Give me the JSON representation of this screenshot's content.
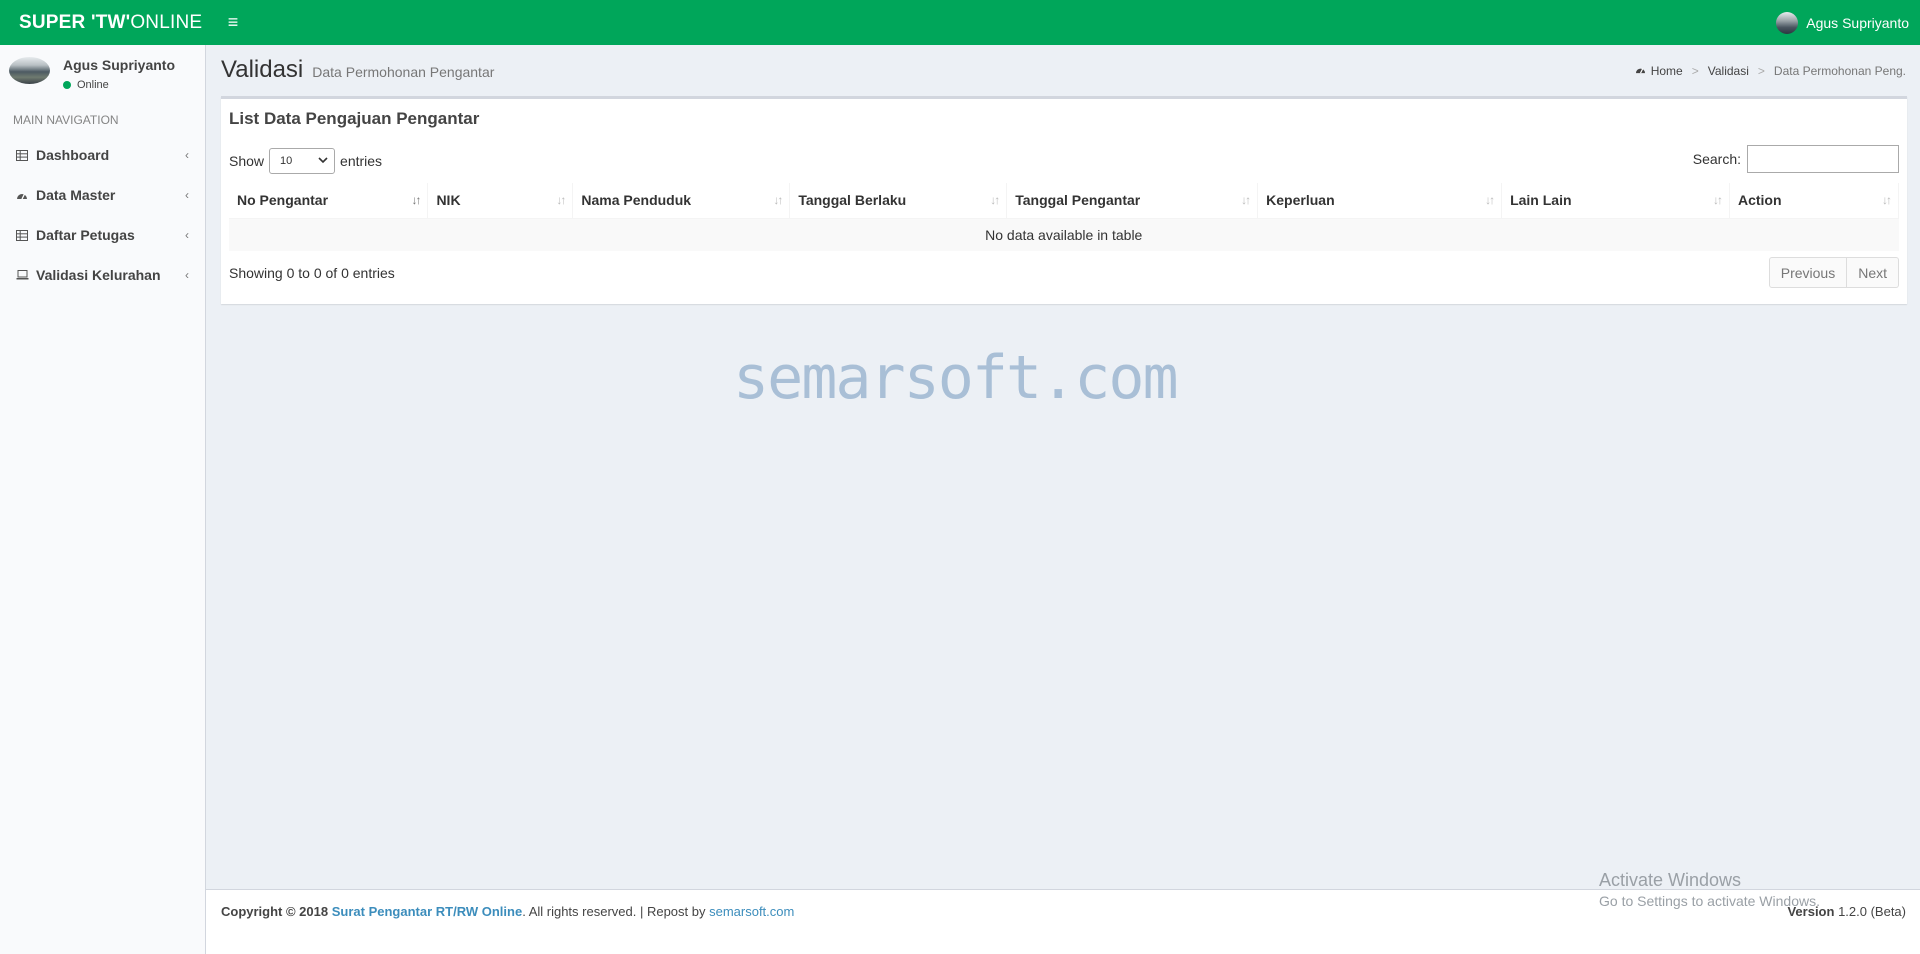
{
  "app": {
    "logo_bold": "SUPER 'TW'",
    "logo_rest": "ONLINE",
    "user_name": "Agus Supriyanto"
  },
  "sidebar": {
    "user_name": "Agus Supriyanto",
    "status": "Online",
    "nav_header": "MAIN NAVIGATION",
    "items": [
      {
        "label": "Dashboard",
        "icon": "table-icon"
      },
      {
        "label": "Data Master",
        "icon": "dashboard-icon"
      },
      {
        "label": "Daftar Petugas",
        "icon": "table-icon"
      },
      {
        "label": "Validasi Kelurahan",
        "icon": "laptop-icon"
      }
    ]
  },
  "content_header": {
    "title": "Validasi",
    "subtitle": "Data Permohonan Pengantar"
  },
  "breadcrumb": {
    "home": "Home",
    "section": "Validasi",
    "current": "Data Permohonan Peng."
  },
  "box": {
    "title": "List Data Pengajuan Pengantar",
    "show_label": "Show",
    "entries_label": "entries",
    "page_length": "10",
    "search_label": "Search:",
    "search_value": ""
  },
  "table": {
    "columns": [
      "No Pengantar",
      "NIK",
      "Nama Penduduk",
      "Tanggal Berlaku",
      "Tanggal Pengantar",
      "Keperluan",
      "Lain Lain",
      "Action"
    ],
    "empty_message": "No data available in table"
  },
  "pagination": {
    "info": "Showing 0 to 0 of 0 entries",
    "previous": "Previous",
    "next": "Next"
  },
  "watermark": "semarsoft.com",
  "footer": {
    "copyright": "Copyright © 2018",
    "app_link": "Surat Pengantar RT/RW Online",
    "rights": ". All rights reserved. | Repost by ",
    "repost_link": "semarsoft.com",
    "version_label": "Version",
    "version_value": "1.2.0 (Beta)"
  },
  "windows_activation": {
    "title": "Activate Windows",
    "subtitle": "Go to Settings to activate Windows."
  },
  "colors": {
    "header_bg": "#00a65a",
    "link": "#3c8dbc",
    "content_bg": "#ecf0f5"
  }
}
